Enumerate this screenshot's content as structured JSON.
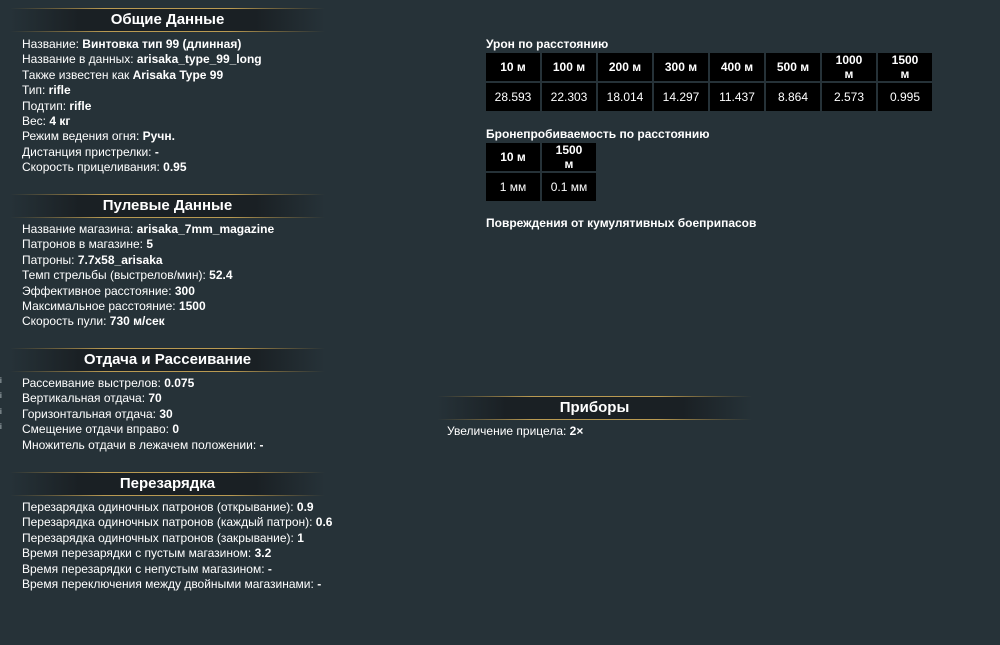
{
  "general": {
    "title": "Общие Данные",
    "rows": [
      {
        "label": "Название: ",
        "value": "Винтовка тип 99 (длинная)"
      },
      {
        "label": "Название в данных: ",
        "value": "arisaka_type_99_long"
      },
      {
        "label": "Также известен как ",
        "value": "Arisaka Type 99"
      },
      {
        "label": "Тип: ",
        "value": "rifle"
      },
      {
        "label": "Подтип: ",
        "value": "rifle"
      },
      {
        "label": "Вес: ",
        "value": "4 кг"
      },
      {
        "label": "Режим ведения огня: ",
        "value": "Ручн."
      },
      {
        "label": "Дистанция пристрелки: ",
        "value": "-"
      },
      {
        "label": "Скорость прицеливания: ",
        "value": "0.95"
      }
    ]
  },
  "bullet": {
    "title": "Пулевые Данные",
    "rows": [
      {
        "label": "Название магазина: ",
        "value": "arisaka_7mm_magazine"
      },
      {
        "label": "Патронов в магазине: ",
        "value": "5"
      },
      {
        "label": "Патроны: ",
        "value": "7.7x58_arisaka"
      },
      {
        "label": "Темп стрельбы (выстрелов/мин): ",
        "value": "52.4"
      },
      {
        "label": "Эффективное расстояние: ",
        "value": "300"
      },
      {
        "label": "Максимальное расстояние: ",
        "value": "1500"
      },
      {
        "label": "Скорость пули: ",
        "value": "730 м/сек"
      }
    ]
  },
  "recoil": {
    "title": "Отдача и Рассеивание",
    "info_icon": "i",
    "rows": [
      {
        "label": "Рассеивание выстрелов: ",
        "value": "0.075"
      },
      {
        "label": "Вертикальная отдача: ",
        "value": "70"
      },
      {
        "label": "Горизонтальная отдача: ",
        "value": "30"
      },
      {
        "label": "Смещение отдачи вправо: ",
        "value": "0"
      },
      {
        "label": "Множитель отдачи в лежачем положении: ",
        "value": "-"
      }
    ]
  },
  "reload": {
    "title": "Перезарядка",
    "rows": [
      {
        "label": "Перезарядка одиночных патронов (открывание): ",
        "value": "0.9"
      },
      {
        "label": "Перезарядка одиночных патронов (каждый патрон): ",
        "value": "0.6"
      },
      {
        "label": "Перезарядка одиночных патронов (закрывание): ",
        "value": "1"
      },
      {
        "label": "Время перезарядки с пустым магазином: ",
        "value": "3.2"
      },
      {
        "label": "Время перезарядки с непустым магазином: ",
        "value": "-"
      },
      {
        "label": "Время переключения между двойными магазинами: ",
        "value": "-"
      }
    ]
  },
  "damage": {
    "title": "Урон по расстоянию",
    "headers": [
      "10 м",
      "100 м",
      "200 м",
      "300 м",
      "400 м",
      "500 м",
      "1000 м",
      "1500 м"
    ],
    "values": [
      "28.593",
      "22.303",
      "18.014",
      "14.297",
      "11.437",
      "8.864",
      "2.573",
      "0.995"
    ]
  },
  "penetration": {
    "title": "Бронепробиваемость по расстоянию",
    "headers": [
      "10 м",
      "1500 м"
    ],
    "values": [
      "1 мм",
      "0.1 мм"
    ]
  },
  "cumulative": {
    "title": "Повреждения от кумулятивных боеприпасов"
  },
  "devices": {
    "title": "Приборы",
    "rows": [
      {
        "label": "Увеличение прицела: ",
        "value": "2×"
      }
    ]
  }
}
